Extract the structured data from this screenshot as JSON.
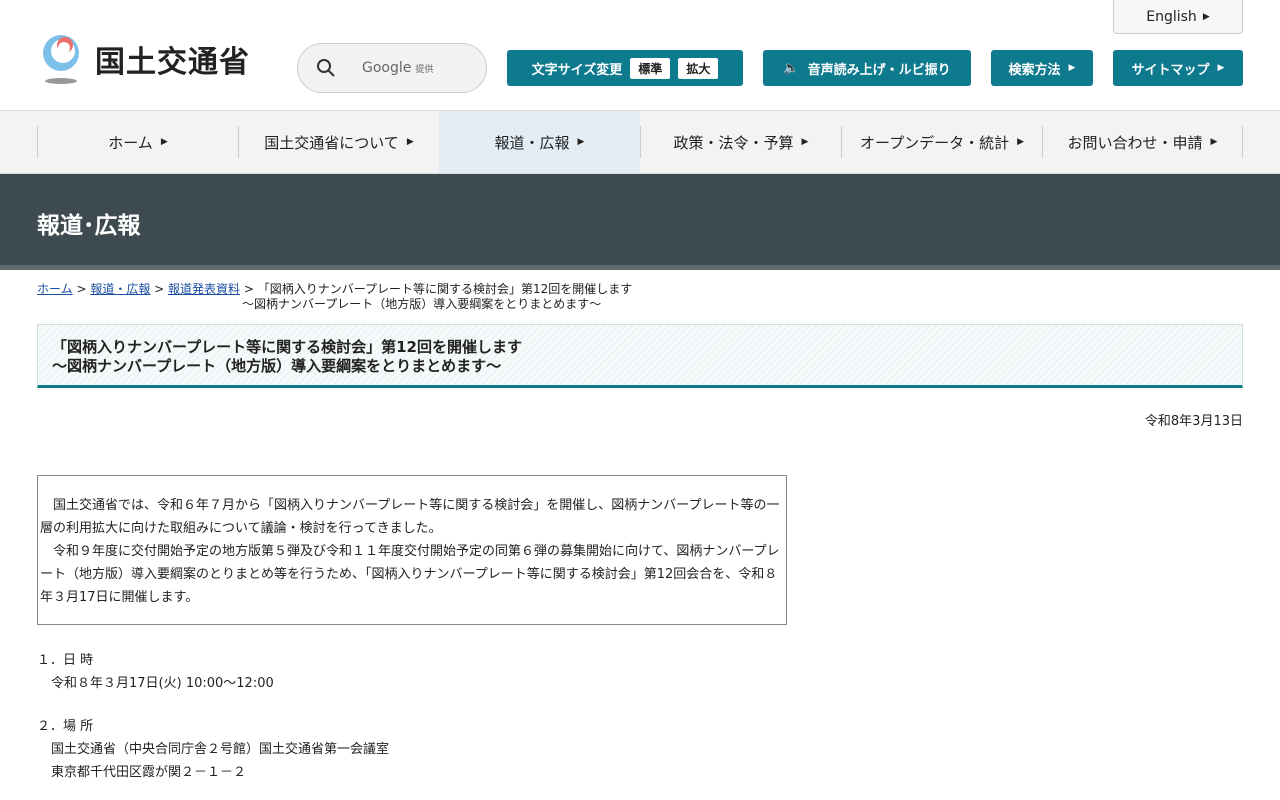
{
  "header": {
    "logo_text": "国土交通省",
    "english": "English",
    "search_brand": "Google",
    "search_provided": "提供",
    "font_size_label": "文字サイズ変更",
    "font_standard": "標準",
    "font_large": "拡大",
    "speech": "音声読み上げ・ルビ振り",
    "search_method": "検索方法",
    "sitemap": "サイトマップ"
  },
  "nav": [
    "ホーム",
    "国土交通省について",
    "報道・広報",
    "政策・法令・予算",
    "オープンデータ・統計",
    "お問い合わせ・申請"
  ],
  "banner": "報道･広報",
  "breadcrumb": {
    "home": "ホーム",
    "press": "報道・広報",
    "releases": "報道発表資料",
    "current1": "「図柄入りナンバープレート等に関する検討会」第12回を開催します",
    "current2": "～図柄ナンバープレート（地方版）導入要綱案をとりまとめます～"
  },
  "title": {
    "line1": "「図柄入りナンバープレート等に関する検討会」第12回を開催します",
    "line2": "～図柄ナンバープレート（地方版）導入要綱案をとりまとめます～"
  },
  "date": "令和8年3月13日",
  "summary": {
    "p1": "　国土交通省では、令和６年７月から「図柄入りナンバープレート等に関する検討会」を開催し、図柄ナンバープレート等の一層の利用拡大に向けた取組みについて議論・検討を行ってきました。",
    "p2": "　令和９年度に交付開始予定の地方版第５弾及び令和１１年度交付開始予定の同第６弾の募集開始に向けて、図柄ナンバープレート（地方版）導入要綱案のとりまとめ等を行うため、「図柄入りナンバープレート等に関する検討会」第12回会合を、令和８年３月17日に開催します。"
  },
  "sections": [
    {
      "heading": "１．日 時",
      "lines": [
        "令和８年３月17日(火) 10:00～12:00"
      ]
    },
    {
      "heading": "２．場 所",
      "lines": [
        "国土交通省（中央合同庁舎２号館）国土交通省第一会議室",
        "東京都千代田区霞が関２－１－２"
      ]
    }
  ]
}
